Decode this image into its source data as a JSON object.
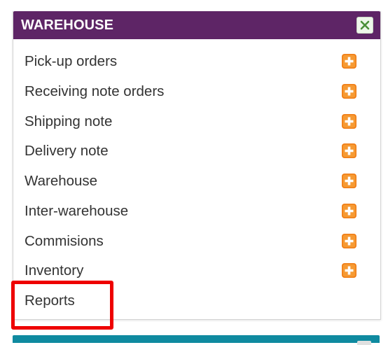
{
  "panel": {
    "title": "WAREHOUSE",
    "header_color": "#5e2566",
    "close_icon": "close-x-icon",
    "items": [
      {
        "label": "Pick-up orders",
        "has_add": true
      },
      {
        "label": "Receiving note orders",
        "has_add": true
      },
      {
        "label": "Shipping note",
        "has_add": true
      },
      {
        "label": "Delivery note",
        "has_add": true
      },
      {
        "label": "Warehouse",
        "has_add": true
      },
      {
        "label": "Inter-warehouse",
        "has_add": true
      },
      {
        "label": "Commisions",
        "has_add": true
      },
      {
        "label": "Inventory",
        "has_add": true
      },
      {
        "label": "Reports",
        "has_add": false
      }
    ],
    "add_icon": "plus-add-icon",
    "add_icon_color": "#f07c14"
  },
  "highlight": {
    "target": "Reports",
    "color": "#ee0000"
  },
  "next_panel": {
    "header_color": "#0f8aa0"
  }
}
